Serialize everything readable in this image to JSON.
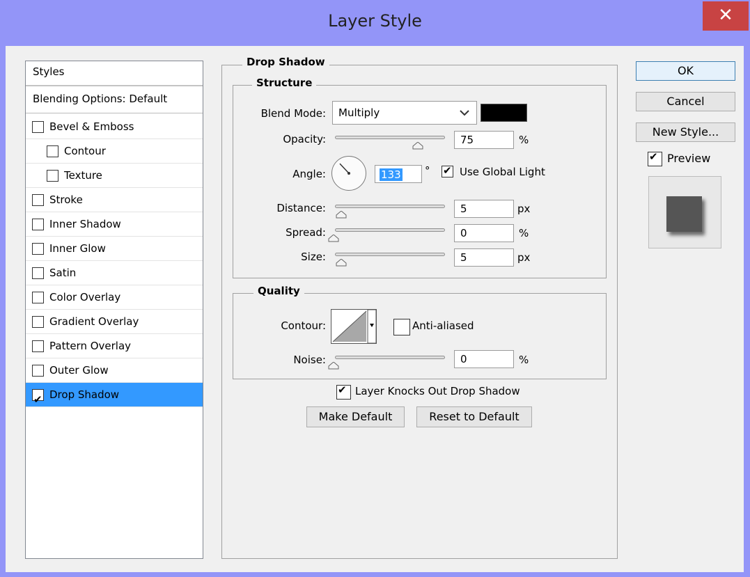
{
  "window": {
    "title": "Layer Style",
    "close_glyph": "✕"
  },
  "styles_panel": {
    "header": "Styles",
    "blending_options": "Blending Options: Default",
    "items": [
      {
        "label": "Bevel & Emboss",
        "checked": false,
        "indent": false
      },
      {
        "label": "Contour",
        "checked": false,
        "indent": true
      },
      {
        "label": "Texture",
        "checked": false,
        "indent": true
      },
      {
        "label": "Stroke",
        "checked": false,
        "indent": false
      },
      {
        "label": "Inner Shadow",
        "checked": false,
        "indent": false
      },
      {
        "label": "Inner Glow",
        "checked": false,
        "indent": false
      },
      {
        "label": "Satin",
        "checked": false,
        "indent": false
      },
      {
        "label": "Color Overlay",
        "checked": false,
        "indent": false
      },
      {
        "label": "Gradient Overlay",
        "checked": false,
        "indent": false
      },
      {
        "label": "Pattern Overlay",
        "checked": false,
        "indent": false
      },
      {
        "label": "Outer Glow",
        "checked": false,
        "indent": false
      },
      {
        "label": "Drop Shadow",
        "checked": true,
        "indent": false,
        "selected": true
      }
    ]
  },
  "drop_shadow": {
    "title": "Drop Shadow",
    "structure": {
      "title": "Structure",
      "blend_mode_label": "Blend Mode:",
      "blend_mode_value": "Multiply",
      "shadow_color": "#000000",
      "opacity_label": "Opacity:",
      "opacity_value": "75",
      "opacity_unit": "%",
      "opacity_fraction": 0.75,
      "angle_label": "Angle:",
      "angle_value": "133",
      "angle_unit": "°",
      "use_global_light_label": "Use Global Light",
      "use_global_light_checked": true,
      "distance_label": "Distance:",
      "distance_value": "5",
      "distance_unit": "px",
      "spread_label": "Spread:",
      "spread_value": "0",
      "spread_unit": "%",
      "size_label": "Size:",
      "size_value": "5",
      "size_unit": "px"
    },
    "quality": {
      "title": "Quality",
      "contour_label": "Contour:",
      "anti_aliased_label": "Anti-aliased",
      "anti_aliased_checked": false,
      "noise_label": "Noise:",
      "noise_value": "0",
      "noise_unit": "%"
    },
    "layer_knocks_out_label": "Layer Knocks Out Drop Shadow",
    "layer_knocks_out_checked": true,
    "make_default_label": "Make Default",
    "reset_default_label": "Reset to Default"
  },
  "actions": {
    "ok_label": "OK",
    "cancel_label": "Cancel",
    "new_style_label": "New Style...",
    "preview_label": "Preview",
    "preview_checked": true
  },
  "colors": {
    "title_bar": "#9395f8",
    "close_button": "#c84343",
    "selection": "#3399ff"
  }
}
